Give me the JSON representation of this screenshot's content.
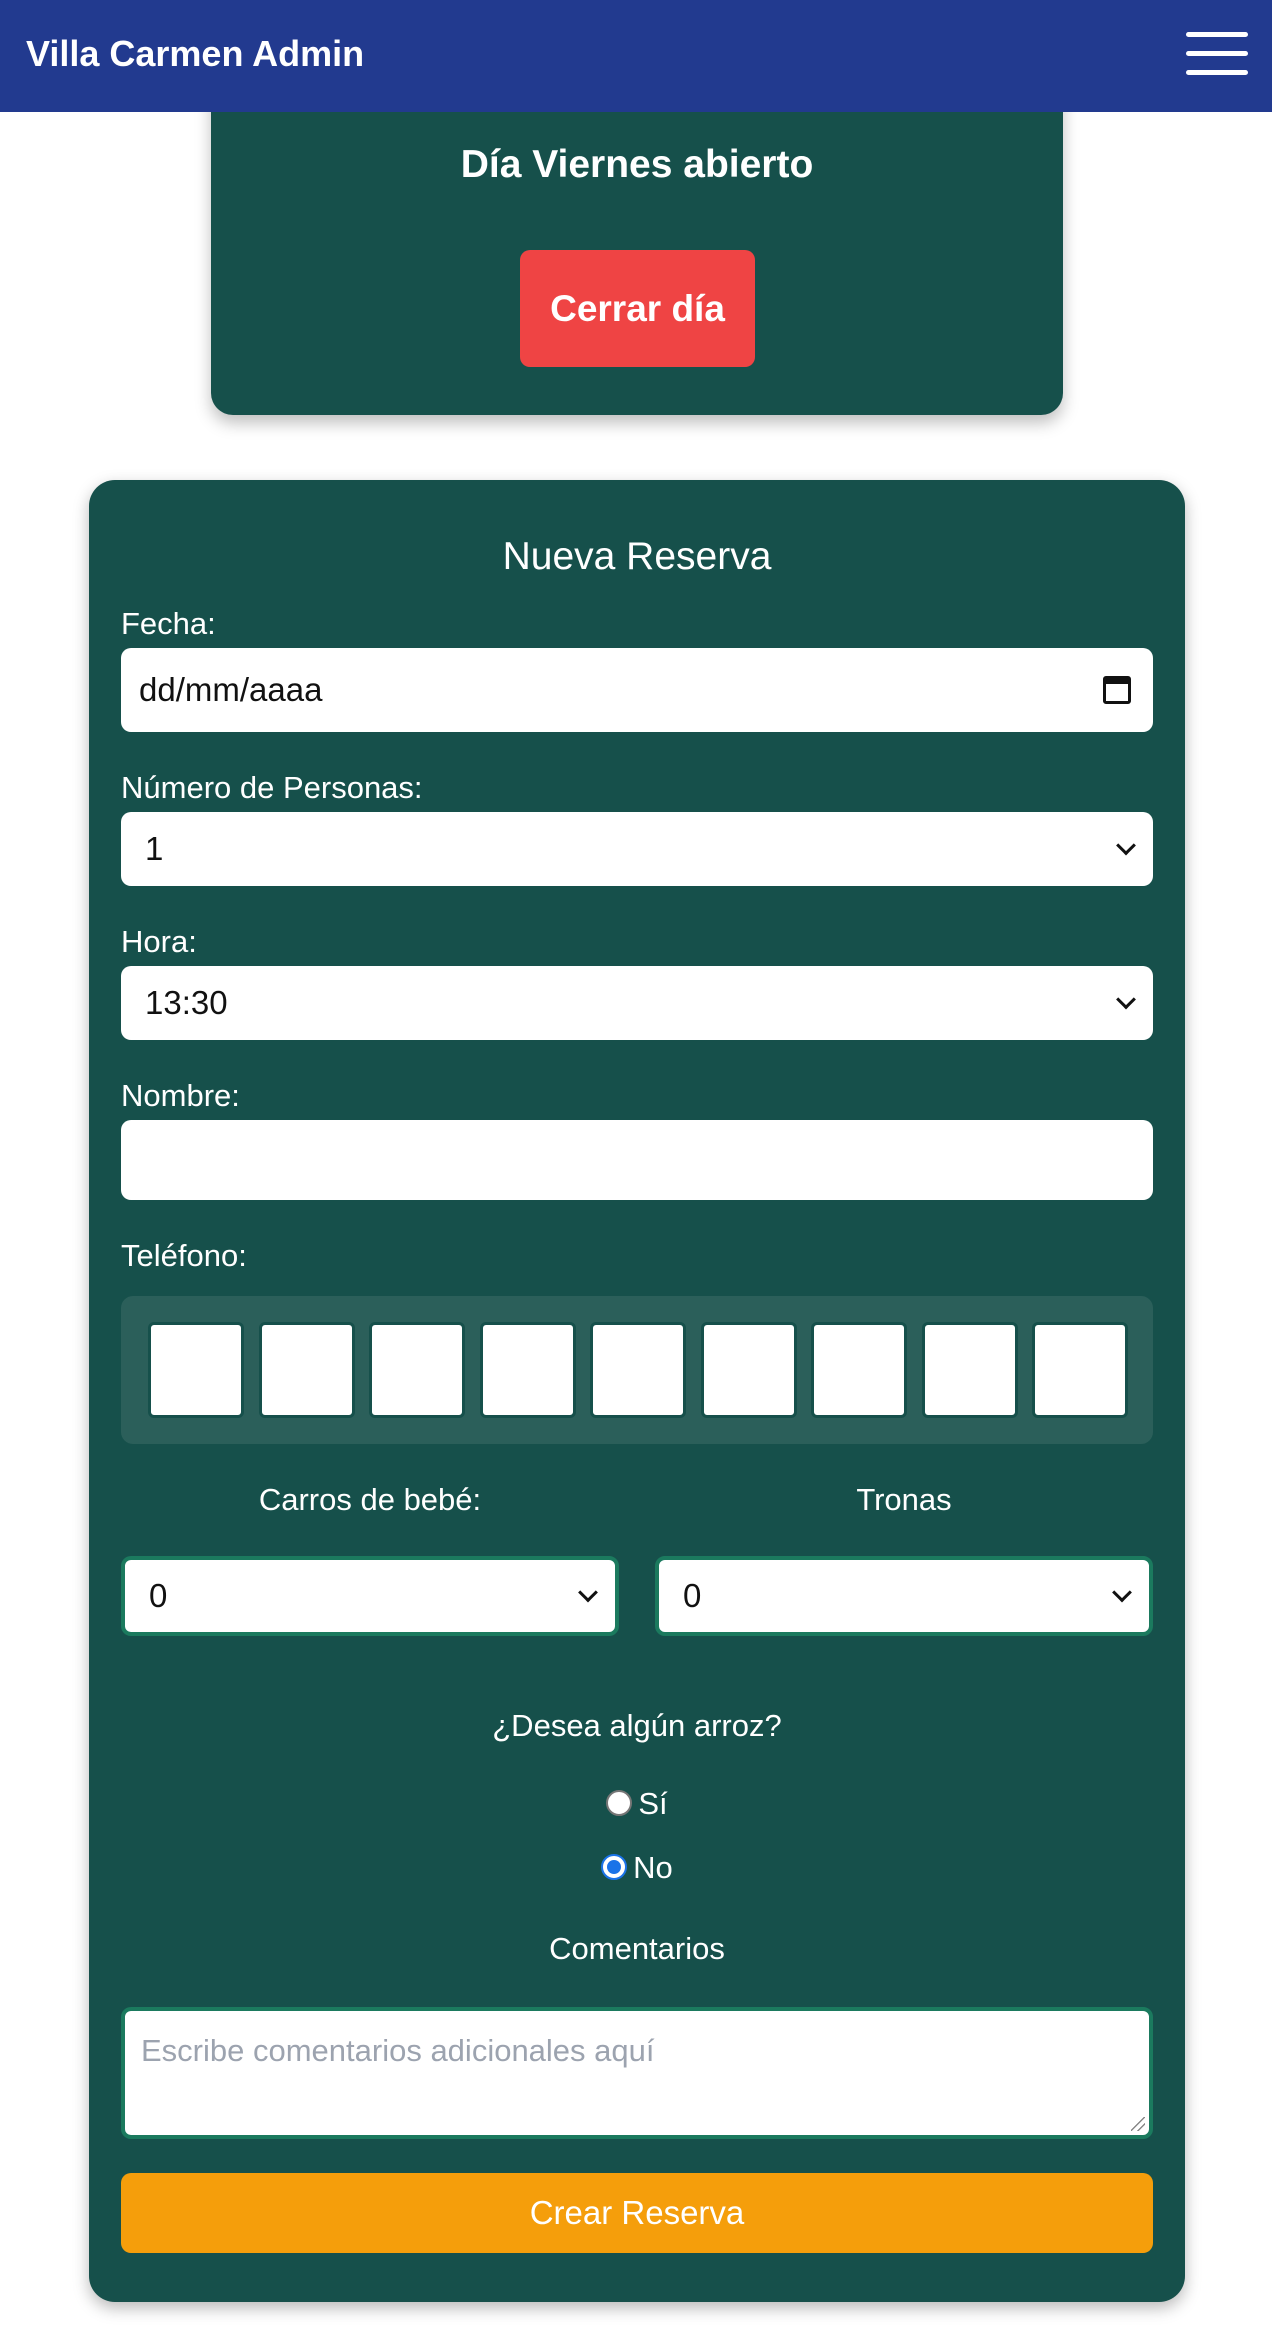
{
  "header": {
    "title": "Villa Carmen Admin",
    "menu_icon": "hamburger-menu-icon"
  },
  "day_status": {
    "title": "Día Viernes abierto",
    "close_button": "Cerrar día"
  },
  "form": {
    "title": "Nueva Reserva",
    "fecha": {
      "label": "Fecha:",
      "value": "dd/mm/aaaa",
      "icon": "calendar-icon"
    },
    "personas": {
      "label": "Número de Personas:",
      "value": "1"
    },
    "hora": {
      "label": "Hora:",
      "value": "13:30"
    },
    "nombre": {
      "label": "Nombre:",
      "value": ""
    },
    "telefono": {
      "label": "Teléfono:",
      "digits": [
        "",
        "",
        "",
        "",
        "",
        "",
        "",
        "",
        ""
      ]
    },
    "carros": {
      "label": "Carros de bebé:",
      "value": "0"
    },
    "tronas": {
      "label": "Tronas",
      "value": "0"
    },
    "arroz": {
      "question": "¿Desea algún arroz?",
      "options": [
        "Sí",
        "No"
      ],
      "selected": "No"
    },
    "comentarios": {
      "label": "Comentarios",
      "placeholder": "Escribe comentarios adicionales aquí"
    },
    "submit": "Crear Reserva"
  },
  "colors": {
    "header": "#223a8f",
    "card": "#16504b",
    "danger": "#ef4444",
    "submit": "#f59e0b"
  }
}
